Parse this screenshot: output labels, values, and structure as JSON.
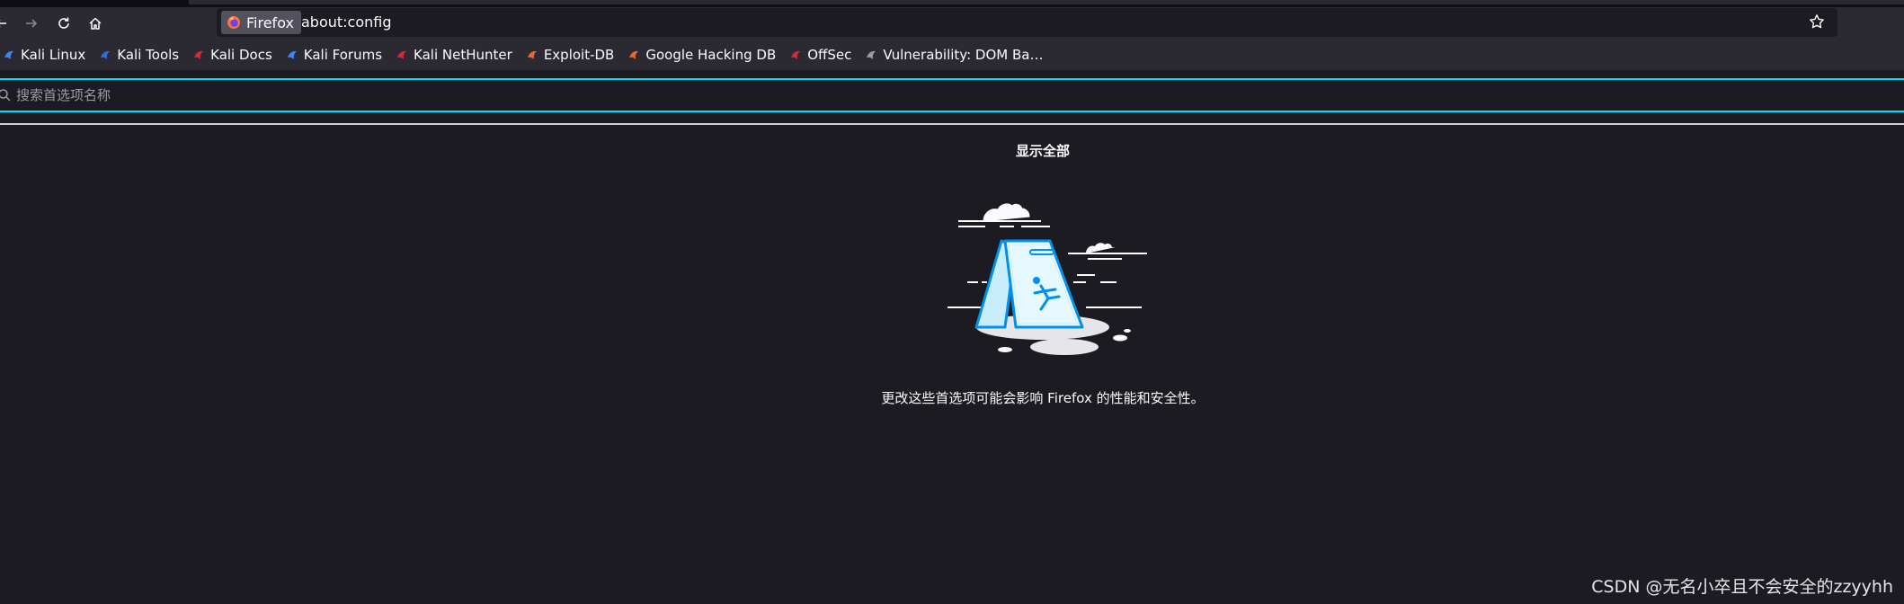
{
  "navbar": {
    "identity_label": "Firefox",
    "url": "about:config"
  },
  "bookmarks": [
    {
      "label": "Kali Linux",
      "icon": "kali-dragon-icon",
      "color": "#3a86ff"
    },
    {
      "label": "Kali Tools",
      "icon": "kali-tools-icon",
      "color": "#2f6fd8"
    },
    {
      "label": "Kali Docs",
      "icon": "kali-docs-icon",
      "color": "#d62839"
    },
    {
      "label": "Kali Forums",
      "icon": "kali-forums-icon",
      "color": "#3a86ff"
    },
    {
      "label": "Kali NetHunter",
      "icon": "nethunter-icon",
      "color": "#d62839"
    },
    {
      "label": "Exploit-DB",
      "icon": "exploit-db-icon",
      "color": "#e8692c"
    },
    {
      "label": "Google Hacking DB",
      "icon": "ghdb-icon",
      "color": "#e8692c"
    },
    {
      "label": "OffSec",
      "icon": "offsec-icon",
      "color": "#d62839"
    },
    {
      "label": "Vulnerability: DOM Ba…",
      "icon": "dvwa-icon",
      "color": "#9b9ba6"
    }
  ],
  "config": {
    "search_placeholder": "搜索首选项名称",
    "show_all_label": "显示全部",
    "warning_text": "更改这些首选项可能会影响 Firefox 的性能和安全性。"
  },
  "watermark": "CSDN @无名小卒且不会安全的zzyyhh",
  "colors": {
    "accent": "#00ddff",
    "illustration": "#0090ed",
    "background": "#1c1b22",
    "toolbar": "#2b2a33"
  }
}
